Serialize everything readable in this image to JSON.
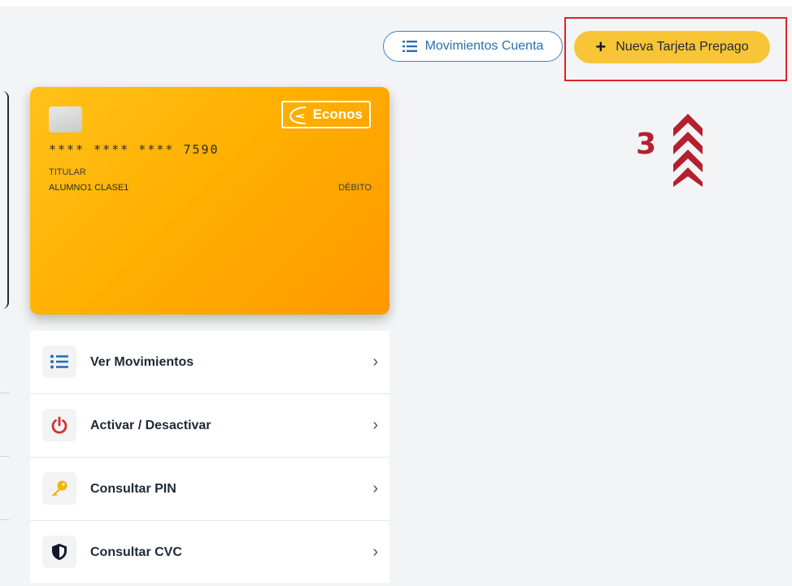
{
  "header": {
    "account_movements_label": "Movimientos Cuenta",
    "new_card_label": "Nueva Tarjeta Prepago"
  },
  "annotation": {
    "step_number": "3"
  },
  "card": {
    "brand": "Econos",
    "number": "**** **** **** 7590",
    "holder_label": "TITULAR",
    "holder_name": "ALUMNO1 CLASE1",
    "type": "DÉBITO"
  },
  "actions": [
    {
      "label": "Ver Movimientos",
      "icon": "list-icon"
    },
    {
      "label": "Activar / Desactivar",
      "icon": "power-icon"
    },
    {
      "label": "Consultar PIN",
      "icon": "key-icon"
    },
    {
      "label": "Consultar CVC",
      "icon": "shield-icon"
    }
  ],
  "colors": {
    "primary_button": "#f8c537",
    "outline_button": "#3b82c4",
    "highlight": "#e0232a",
    "annotation": "#b4202d",
    "card_gradient_start": "#ffc21a",
    "card_gradient_end": "#ff9800"
  }
}
